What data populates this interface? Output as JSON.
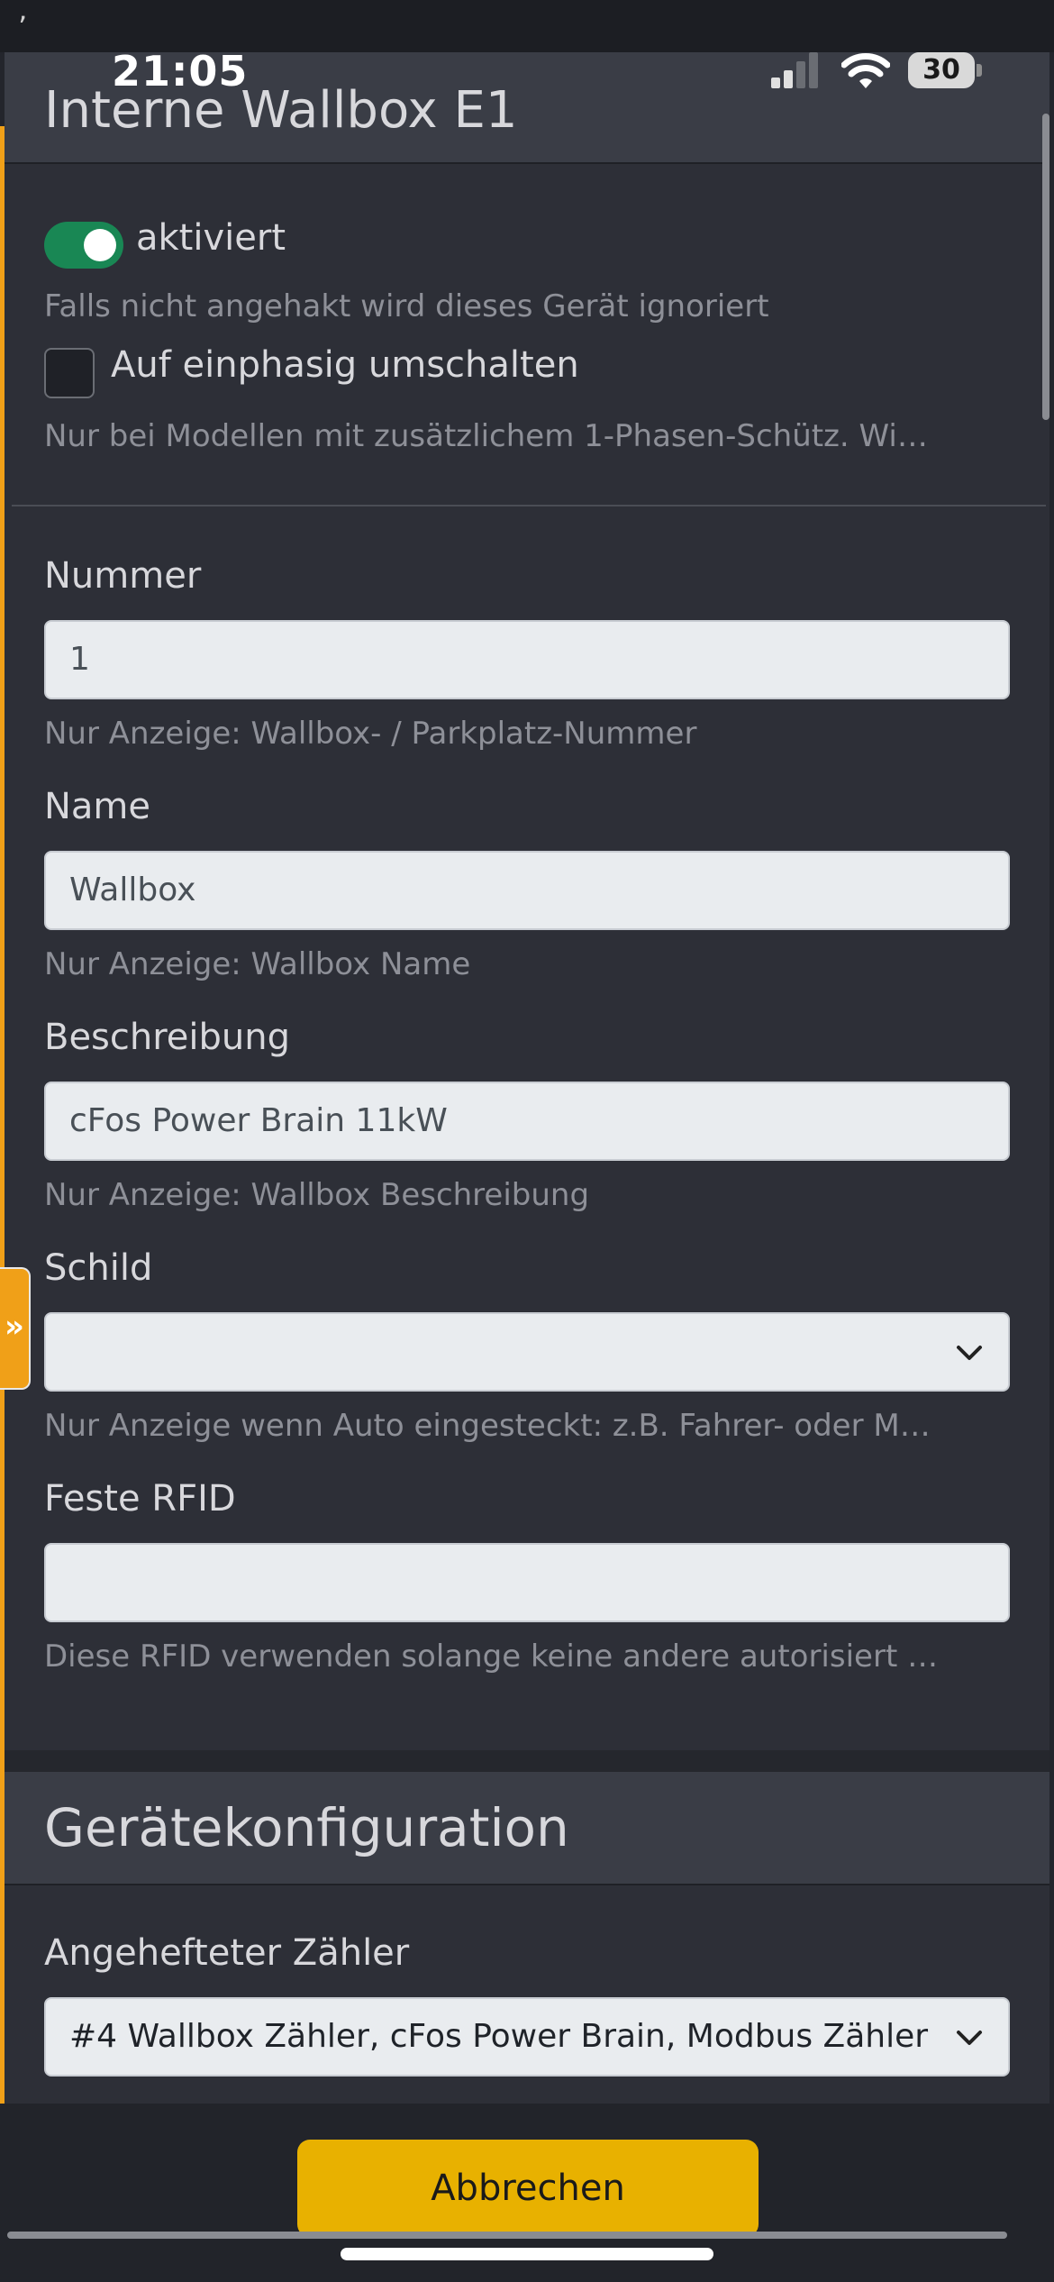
{
  "status_bar": {
    "time": "21:05",
    "battery": "30",
    "tick": "’"
  },
  "header": {
    "title": "Interne Wallbox E1"
  },
  "enabled": {
    "label": "aktiviert",
    "help": "Falls nicht angehakt wird dieses Gerät ignoriert",
    "on": true
  },
  "single_phase": {
    "label": "Auf einphasig umschalten",
    "help": "Nur bei Modellen mit zusätzlichem 1-Phasen-Schütz. Wi…"
  },
  "fields": {
    "nummer": {
      "label": "Nummer",
      "value": "1",
      "help": "Nur Anzeige: Wallbox- / Parkplatz-Nummer"
    },
    "name": {
      "label": "Name",
      "value": "Wallbox",
      "help": "Nur Anzeige: Wallbox Name"
    },
    "beschreibung": {
      "label": "Beschreibung",
      "value": "cFos Power Brain 11kW",
      "help": "Nur Anzeige: Wallbox Beschreibung"
    },
    "schild": {
      "label": "Schild",
      "value": "",
      "help": "Nur Anzeige wenn Auto eingesteckt: z.B. Fahrer- oder M…"
    },
    "rfid": {
      "label": "Feste RFID",
      "value": "",
      "help": "Diese RFID verwenden solange keine andere autorisiert …"
    }
  },
  "device_config": {
    "title": "Gerätekonfiguration",
    "meter_label": "Angehefteter Zähler",
    "meter_value": "#4 Wallbox Zähler, cFos Power Brain, Modbus Zähler"
  },
  "side_tab": {
    "icon": "double-chevron-right-icon",
    "glyph": "»"
  },
  "footer": {
    "cancel_label": "Abbrechen"
  },
  "colors": {
    "accent_orange": "#f0a018",
    "toggle_green": "#198754",
    "button_yellow": "#e8b100"
  }
}
